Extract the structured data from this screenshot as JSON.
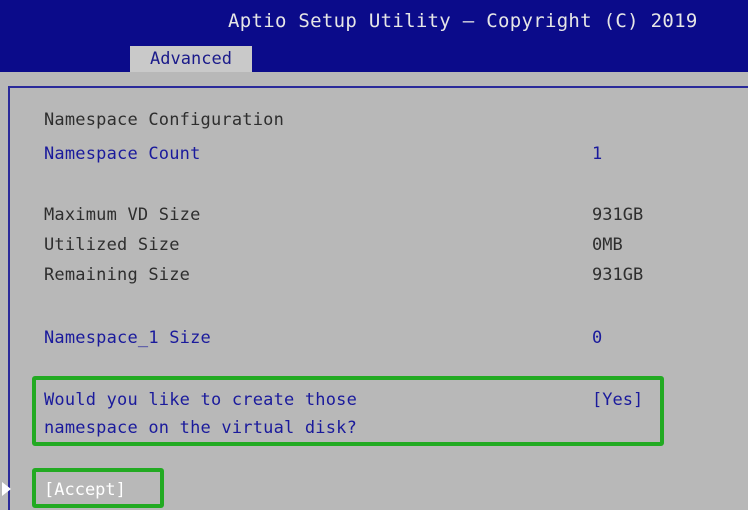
{
  "header": {
    "title": "Aptio Setup Utility – Copyright (C) 2019",
    "active_tab": "Advanced"
  },
  "settings": {
    "section_title": "Namespace Configuration",
    "namespace_count_label": "Namespace Count",
    "namespace_count_value": "1",
    "max_vd_label": "Maximum VD Size",
    "max_vd_value": "931GB",
    "utilized_label": "Utilized Size",
    "utilized_value": "0MB",
    "remaining_label": "Remaining Size",
    "remaining_value": "931GB",
    "ns1_size_label": "Namespace_1 Size",
    "ns1_size_value": "0",
    "create_prompt_line1": "Would you like to create those",
    "create_prompt_line2": "namespace on the virtual disk?",
    "create_value": "[Yes]",
    "accept_label": "[Accept]"
  },
  "colors": {
    "title_bar": "#0b0b8a",
    "highlight_box": "#22aa22",
    "selectable_text": "#1a1a9c"
  }
}
